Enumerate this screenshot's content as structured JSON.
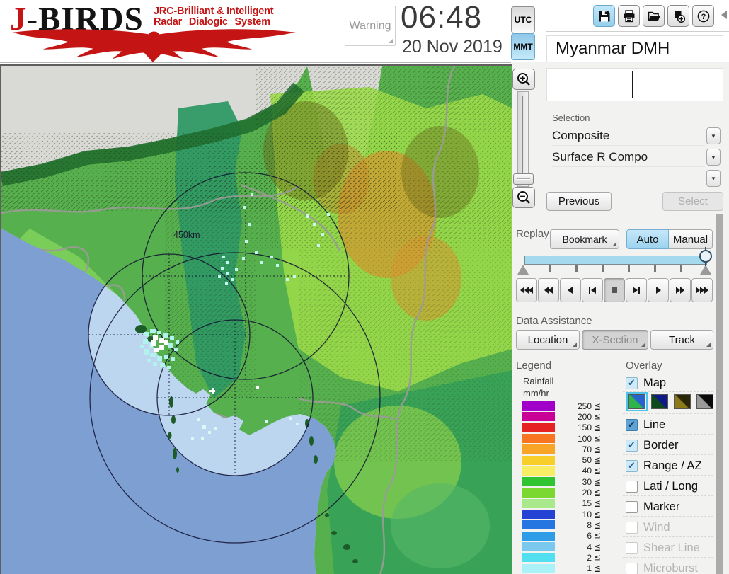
{
  "header": {
    "logo": {
      "j": "J",
      "birds": "-BIRDS",
      "tagline1": "JRC-Brilliant & Intelligent",
      "tagline2": "Radar Dialogic System"
    },
    "warning_label": "Warning",
    "clock": {
      "time": "06:48",
      "date": "20 Nov 2019"
    },
    "timezone": {
      "utc": "UTC",
      "mmt": "MMT",
      "selected": "MMT",
      "mmt_active": true,
      "utc_active": false
    },
    "toolbar": {
      "save_active": true,
      "icons": [
        "save",
        "print",
        "open",
        "add-window",
        "help"
      ]
    }
  },
  "station": {
    "name": "Myanmar DMH",
    "input_value": ""
  },
  "selection": {
    "label": "Selection",
    "fields": [
      {
        "value": "Composite"
      },
      {
        "value": "Surface R Compo"
      },
      {
        "value": ""
      }
    ],
    "previous_label": "Previous",
    "select_label": "Select",
    "select_disabled": true
  },
  "replay": {
    "label": "Replay",
    "bookmark_label": "Bookmark",
    "auto_label": "Auto",
    "manual_label": "Manual",
    "active_mode": "Auto",
    "auto_active": true,
    "playback": [
      {
        "name": "rewind-to-start"
      },
      {
        "name": "fast-rewind"
      },
      {
        "name": "play-backward"
      },
      {
        "name": "step-backward"
      },
      {
        "name": "stop",
        "pressed": true
      },
      {
        "name": "step-forward"
      },
      {
        "name": "play-forward"
      },
      {
        "name": "fast-forward"
      },
      {
        "name": "forward-to-end"
      }
    ]
  },
  "data_assistance": {
    "label": "Data Assistance",
    "buttons": [
      {
        "label": "Location"
      },
      {
        "label": "X-Section",
        "pressed": true
      },
      {
        "label": "Track"
      }
    ]
  },
  "legend": {
    "title": "Legend",
    "line1": "Rainfall",
    "line2": "mm/hr",
    "lte_symbol": "≦",
    "items": [
      {
        "value": "250",
        "color": "#a000c8"
      },
      {
        "value": "200",
        "color": "#c80096"
      },
      {
        "value": "150",
        "color": "#e62222"
      },
      {
        "value": "100",
        "color": "#f87622"
      },
      {
        "value": "70",
        "color": "#f8a426"
      },
      {
        "value": "50",
        "color": "#f8ce2a"
      },
      {
        "value": "40",
        "color": "#f8ee66"
      },
      {
        "value": "30",
        "color": "#30c430"
      },
      {
        "value": "20",
        "color": "#7ad830"
      },
      {
        "value": "15",
        "color": "#aae88c"
      },
      {
        "value": "10",
        "color": "#2442d4"
      },
      {
        "value": "8",
        "color": "#2676e2"
      },
      {
        "value": "6",
        "color": "#2e9ce6"
      },
      {
        "value": "4",
        "color": "#7ac8ee"
      },
      {
        "value": "2",
        "color": "#52e0f0"
      },
      {
        "value": "1",
        "color": "#aaf2f8"
      }
    ]
  },
  "overlay": {
    "title": "Overlay",
    "items": [
      {
        "label": "Map",
        "checked": true
      },
      {
        "label": "Line",
        "checked": true,
        "focused": true
      },
      {
        "label": "Border",
        "checked": true
      },
      {
        "label": "Range / AZ",
        "checked": true
      },
      {
        "label": "Lati / Long",
        "checked": false
      },
      {
        "label": "Marker",
        "checked": false
      },
      {
        "label": "Wind",
        "checked": false,
        "disabled": true
      },
      {
        "label": "Shear Line",
        "checked": false,
        "disabled": true
      },
      {
        "label": "Microburst",
        "checked": false,
        "disabled": true
      }
    ],
    "map_styles": [
      {
        "name": "green-blue",
        "c1": "#2eb44a",
        "c2": "#2a62cc",
        "selected": true
      },
      {
        "name": "dark-green-navy",
        "c1": "#0c4a1c",
        "c2": "#101a86",
        "selected": false
      },
      {
        "name": "olive-dark",
        "c1": "#8a7a1a",
        "c2": "#2a260a",
        "selected": false
      },
      {
        "name": "gray-black",
        "c1": "#9a9a9a",
        "c2": "#0a0a0a",
        "selected": false
      }
    ]
  },
  "map": {
    "range_ring_label": "450km"
  }
}
